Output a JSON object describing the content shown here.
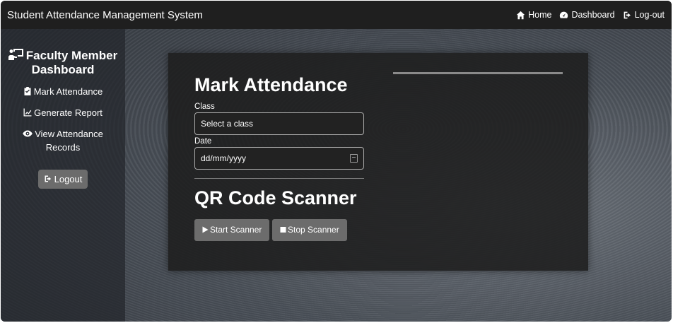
{
  "navbar": {
    "brand": "Student Attendance Management System",
    "links": [
      {
        "label": "Home",
        "icon": "home-icon"
      },
      {
        "label": "Dashboard",
        "icon": "gauge-icon"
      },
      {
        "label": "Log-out",
        "icon": "sign-out-icon"
      }
    ]
  },
  "sidebar": {
    "title": "Faculty Member Dashboard",
    "items": [
      {
        "label": "Mark Attendance",
        "icon": "clipboard-check-icon"
      },
      {
        "label": "Generate Report",
        "icon": "line-chart-icon"
      },
      {
        "label": "View Attendance Records",
        "icon": "eye-icon"
      }
    ],
    "logout_label": "Logout"
  },
  "main": {
    "mark_title": "Mark Attendance",
    "class_label": "Class",
    "class_value": "Select a class",
    "date_label": "Date",
    "date_placeholder": "dd/mm/yyyy",
    "qr_title": "QR Code Scanner",
    "start_label": "Start Scanner",
    "stop_label": "Stop Scanner"
  },
  "colors": {
    "navbar": "#1f1f1f",
    "button": "#6c6c6c",
    "card": "#1e1e1e"
  }
}
